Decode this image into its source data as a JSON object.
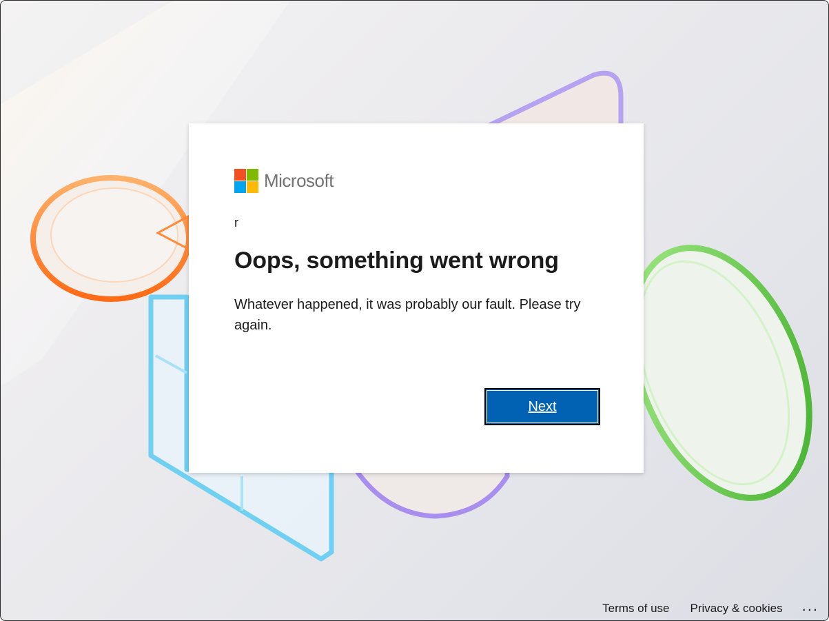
{
  "brand": {
    "name": "Microsoft",
    "logo_colors": [
      "#f25022",
      "#7fba00",
      "#00a4ef",
      "#ffb900"
    ]
  },
  "dialog": {
    "user_identifier": "r",
    "title": "Oops, something went wrong",
    "message": "Whatever happened, it was probably our fault. Please try again.",
    "next_label": "Next"
  },
  "footer": {
    "terms_label": "Terms of use",
    "privacy_label": "Privacy & cookies",
    "more_label": "..."
  },
  "colors": {
    "primary_button": "#0162b4",
    "text": "#1b1b1b"
  }
}
